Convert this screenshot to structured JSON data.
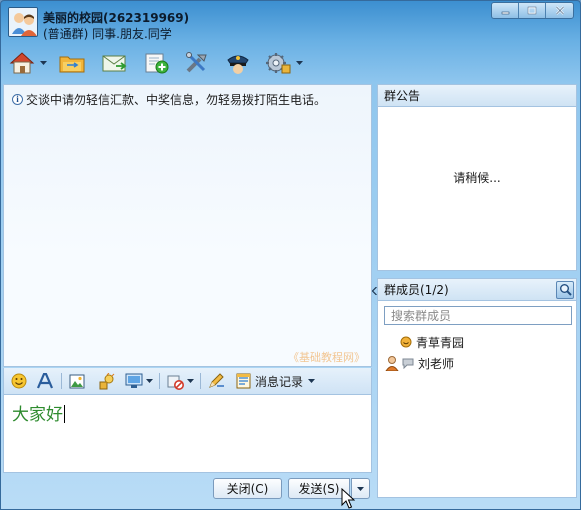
{
  "window": {
    "title": "美丽的校园(262319969)",
    "subtitle": "(普通群) 同事.朋友.同学"
  },
  "toolbar": {
    "icons": [
      "home-icon",
      "folder-icon",
      "mail-icon",
      "add-icon",
      "tools-icon",
      "police-icon",
      "settings-icon"
    ]
  },
  "chat": {
    "notice": "交谈中请勿轻信汇款、中奖信息，勿轻易拨打陌生电话。",
    "watermark": "《基础教程网》"
  },
  "input_toolbar": {
    "history_label": "消息记录"
  },
  "input": {
    "text": "大家好"
  },
  "buttons": {
    "close": "关闭(C)",
    "send": "发送(S)"
  },
  "announcement": {
    "title": "群公告",
    "loading": "请稍候..."
  },
  "members": {
    "title": "群成员(1/2)",
    "search_placeholder": "搜索群成员",
    "list": [
      {
        "name": "青草青园"
      },
      {
        "name": "刘老师"
      }
    ]
  }
}
